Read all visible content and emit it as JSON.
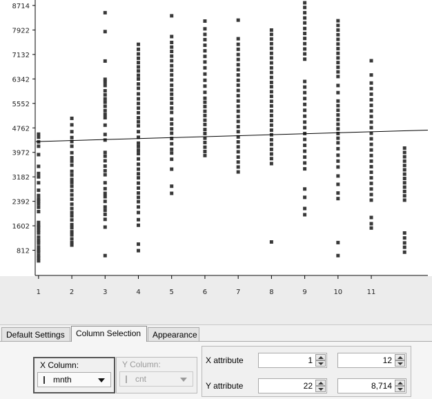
{
  "chart_data": {
    "type": "scatter",
    "title": "",
    "xlabel": "",
    "ylabel": "",
    "x_ticks": [
      "1",
      "2",
      "3",
      "4",
      "5",
      "6",
      "7",
      "8",
      "9",
      "10",
      "11"
    ],
    "y_ticks": [
      "812",
      "1602",
      "2392",
      "3182",
      "3972",
      "4762",
      "5552",
      "6342",
      "7132",
      "7922",
      "8714"
    ],
    "xlim": [
      0.92,
      12.7
    ],
    "ylim": [
      22,
      8890
    ],
    "trend_line": {
      "x": [
        0.92,
        12.7
      ],
      "y": [
        4320,
        4690
      ]
    },
    "series": [
      {
        "x": 1,
        "values": [
          4560,
          4460,
          4310,
          4170,
          3900,
          3520,
          3290,
          3180,
          2990,
          2750,
          2580,
          2470,
          2400,
          2310,
          2200,
          2060,
          1710,
          1610,
          1560,
          1460,
          1370,
          1240,
          1130,
          1040,
          920,
          820,
          750,
          640,
          560,
          470
        ]
      },
      {
        "x": 2,
        "values": [
          5070,
          4860,
          4640,
          4450,
          4320,
          4170,
          3960,
          3800,
          3690,
          3560,
          3360,
          3240,
          3100,
          3000,
          2880,
          2740,
          2600,
          2460,
          2300,
          2160,
          2030,
          1920,
          1790,
          1640,
          1540,
          1410,
          1310,
          1180,
          1060,
          980
        ]
      },
      {
        "x": 3,
        "values": [
          8480,
          7870,
          6920,
          6330,
          6240,
          6130,
          5960,
          5830,
          5700,
          5590,
          5460,
          5320,
          5200,
          5090,
          4850,
          4550,
          4370,
          3970,
          3850,
          3700,
          3530,
          3380,
          3250,
          2990,
          2800,
          2650,
          2540,
          2390,
          2210,
          2100,
          1970,
          1810,
          1560,
          640
        ]
      },
      {
        "x": 4,
        "values": [
          7460,
          7300,
          7150,
          7010,
          6870,
          6730,
          6600,
          6460,
          6340,
          6180,
          6040,
          5860,
          5700,
          5550,
          5400,
          5250,
          5090,
          4960,
          4830,
          4640,
          4460,
          4270,
          4160,
          4040,
          3930,
          3760,
          3590,
          3430,
          3280,
          3150,
          2980,
          2820,
          2660,
          2520,
          2380,
          2210,
          2030,
          1800,
          1620,
          1010,
          800
        ]
      },
      {
        "x": 5,
        "values": [
          8380,
          7710,
          7520,
          7370,
          7230,
          7080,
          6930,
          6770,
          6620,
          6470,
          6310,
          6140,
          5990,
          5850,
          5710,
          5560,
          5400,
          5260,
          5040,
          4890,
          4730,
          4590,
          4420,
          4250,
          4070,
          3950,
          3750,
          3430,
          2880,
          2650
        ]
      },
      {
        "x": 6,
        "values": [
          8210,
          7960,
          7780,
          7610,
          7430,
          7250,
          7070,
          6890,
          6700,
          6500,
          6300,
          6110,
          5910,
          5720,
          5590,
          5450,
          5300,
          5160,
          5010,
          4870,
          4710,
          4580,
          4430,
          4290,
          4140,
          4000,
          3870
        ]
      },
      {
        "x": 7,
        "values": [
          8240,
          7640,
          7460,
          7300,
          7130,
          6970,
          6800,
          6640,
          6470,
          6300,
          6140,
          5970,
          5800,
          5630,
          5460,
          5300,
          5130,
          4970,
          4800,
          4640,
          4470,
          4310,
          4150,
          3990,
          3820,
          3660,
          3500,
          3340
        ]
      },
      {
        "x": 8,
        "values": [
          7920,
          7780,
          7630,
          7480,
          7330,
          7170,
          7020,
          6860,
          6700,
          6550,
          6390,
          6230,
          6090,
          5930,
          5780,
          5620,
          5470,
          5310,
          5160,
          5000,
          4850,
          4690,
          4540,
          4380,
          4230,
          4070,
          3920,
          3770,
          3610,
          1080
        ]
      },
      {
        "x": 9,
        "values": [
          8800,
          8650,
          8480,
          8310,
          8150,
          7970,
          7810,
          7650,
          7480,
          7310,
          7150,
          6980,
          6260,
          6080,
          5900,
          5710,
          5520,
          5330,
          5140,
          4950,
          4770,
          4580,
          4390,
          4200,
          4010,
          3820,
          3630,
          3440,
          2790,
          2520,
          2160,
          1960
        ]
      },
      {
        "x": 10,
        "values": [
          8220,
          8070,
          7920,
          7770,
          7620,
          7470,
          7320,
          7170,
          7020,
          6870,
          6720,
          6570,
          6420,
          6130,
          5900,
          5630,
          5480,
          5330,
          5180,
          5030,
          4880,
          4730,
          4580,
          4430,
          4280,
          4090,
          3880,
          3690,
          3500,
          3210,
          2940,
          2660,
          2480,
          1060,
          640
        ]
      },
      {
        "x": 11,
        "values": [
          6930,
          6470,
          6210,
          6030,
          5850,
          5670,
          5490,
          5310,
          5130,
          4950,
          4770,
          4590,
          4410,
          4230,
          4050,
          3870,
          3690,
          3510,
          3330,
          3150,
          2970,
          2790,
          2610,
          2430,
          1870,
          1670,
          1530
        ]
      },
      {
        "x": 12,
        "values": [
          4110,
          3970,
          3830,
          3690,
          3550,
          3410,
          3270,
          3130,
          2990,
          2850,
          2710,
          2570,
          2430,
          1370,
          1210,
          1050,
          910,
          750
        ]
      }
    ],
    "grid": false,
    "legend": "none",
    "colors": {
      "points": "#383838",
      "line": "#000000",
      "background": "#ffffff"
    }
  },
  "tabs": [
    {
      "label": "Default Settings",
      "active": false
    },
    {
      "label": "Column Selection",
      "active": true
    },
    {
      "label": "Appearance",
      "active": false
    }
  ],
  "column_selection": {
    "x_column": {
      "caption": "X Column:",
      "value": "mnth"
    },
    "y_column": {
      "caption": "Y Column:",
      "value": "cnt"
    }
  },
  "range": {
    "x_label": "X attribute",
    "x_min": "1",
    "x_max": "12",
    "y_label": "Y attribute",
    "y_min": "22",
    "y_max": "8,714"
  }
}
